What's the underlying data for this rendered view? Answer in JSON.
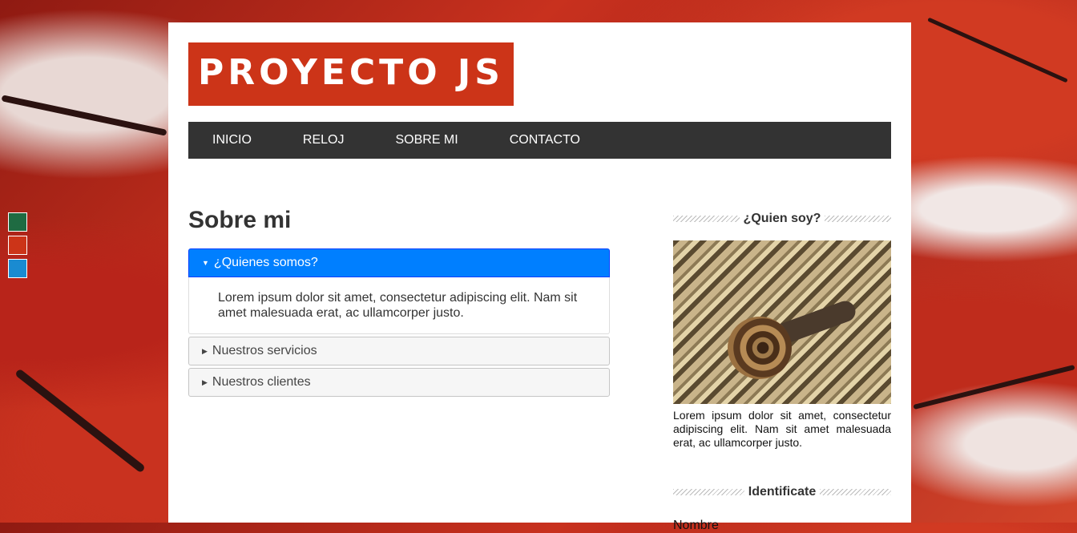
{
  "logo": {
    "text": "PROYECTO JS"
  },
  "theme_switcher": {
    "colors": [
      "#1f6b42",
      "#cc3418",
      "#1a8bd1"
    ]
  },
  "nav": {
    "items": [
      "INICIO",
      "RELOJ",
      "SOBRE MI",
      "CONTACTO"
    ]
  },
  "main": {
    "title": "Sobre mi",
    "accordion": [
      {
        "label": "¿Quienes somos?",
        "active": true,
        "content": "Lorem ipsum dolor sit amet, consectetur adipiscing elit. Nam sit amet malesuada erat, ac ullamcorper justo."
      },
      {
        "label": "Nuestros servicios",
        "active": false
      },
      {
        "label": "Nuestros clientes",
        "active": false
      }
    ]
  },
  "sidebar": {
    "about": {
      "title": "¿Quien soy?",
      "text": "Lorem ipsum dolor sit amet, consectetur adipiscing elit. Nam sit amet malesuada erat, ac ullamcorper justo."
    },
    "form": {
      "title": "Identificate",
      "name_label": "Nombre"
    }
  },
  "colors": {
    "brand": "#cc3418",
    "nav_bg": "#333333",
    "accordion_active": "#007fff"
  }
}
